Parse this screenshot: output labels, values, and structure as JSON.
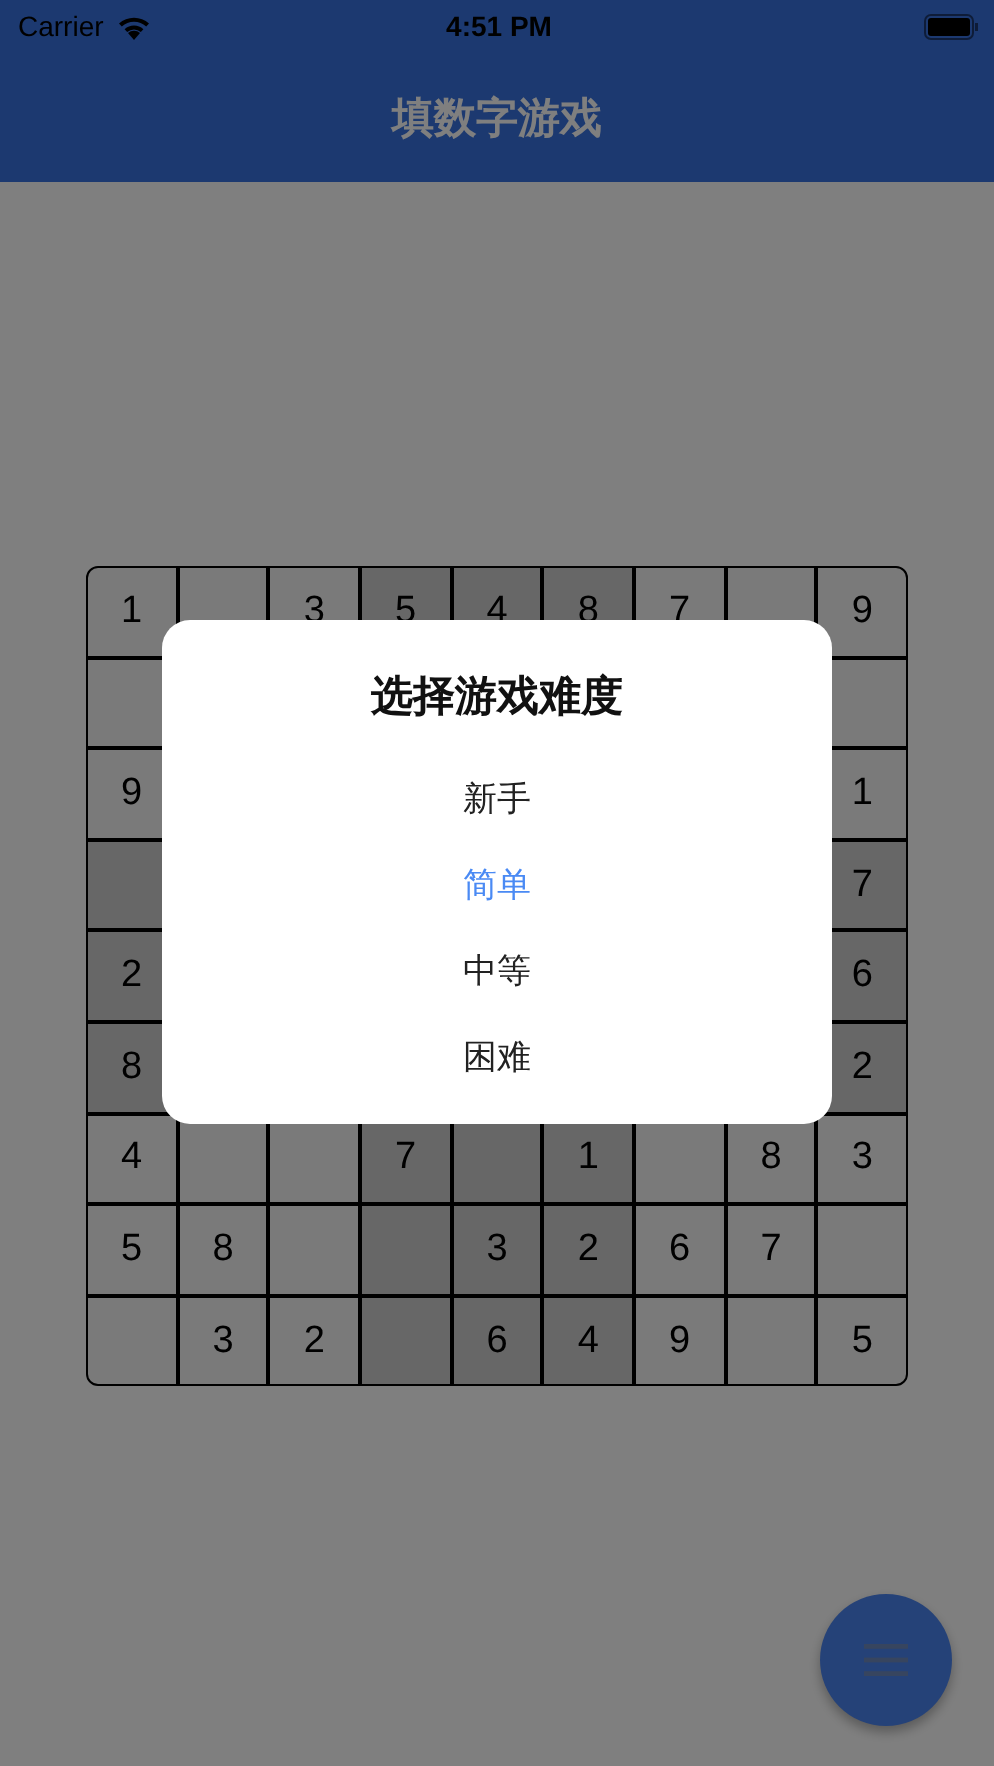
{
  "status_bar": {
    "carrier": "Carrier",
    "time": "4:51 PM"
  },
  "app_bar": {
    "title": "填数字游戏"
  },
  "grid": {
    "rows": [
      [
        {
          "value": "1"
        },
        {},
        {
          "value": "3"
        },
        {
          "value": "5"
        },
        {
          "value": "4"
        },
        {
          "value": "8"
        },
        {
          "value": "7"
        },
        {},
        {
          "value": "9"
        }
      ],
      [
        {},
        {}
      ],
      [
        {
          "value": "9"
        },
        {
          "value": "1"
        }
      ],
      [
        {},
        {
          "value": "7"
        }
      ],
      [
        {
          "value": "2"
        },
        {
          "value": "6"
        }
      ],
      [
        {
          "value": "8"
        },
        {
          "value": "2"
        }
      ],
      [
        {
          "value": "4"
        },
        {},
        {},
        {
          "value": "7"
        },
        {},
        {
          "value": "1"
        },
        {},
        {
          "value": "8"
        },
        {
          "value": "3"
        }
      ],
      [
        {
          "value": "5"
        },
        {
          "value": "8"
        },
        {},
        {},
        {
          "value": "3"
        },
        {
          "value": "2"
        },
        {
          "value": "6"
        },
        {
          "value": "7"
        },
        {}
      ],
      [
        {},
        {
          "value": "3"
        },
        {
          "value": "2"
        },
        {},
        {
          "value": "6"
        },
        {
          "value": "4"
        },
        {
          "value": "9"
        },
        {},
        {
          "value": "5"
        }
      ]
    ]
  },
  "dialog": {
    "title": "选择游戏难度",
    "options": [
      {
        "label": "新手",
        "selected": false
      },
      {
        "label": "简单",
        "selected": true
      },
      {
        "label": "中等",
        "selected": false
      },
      {
        "label": "困难",
        "selected": false
      }
    ]
  }
}
